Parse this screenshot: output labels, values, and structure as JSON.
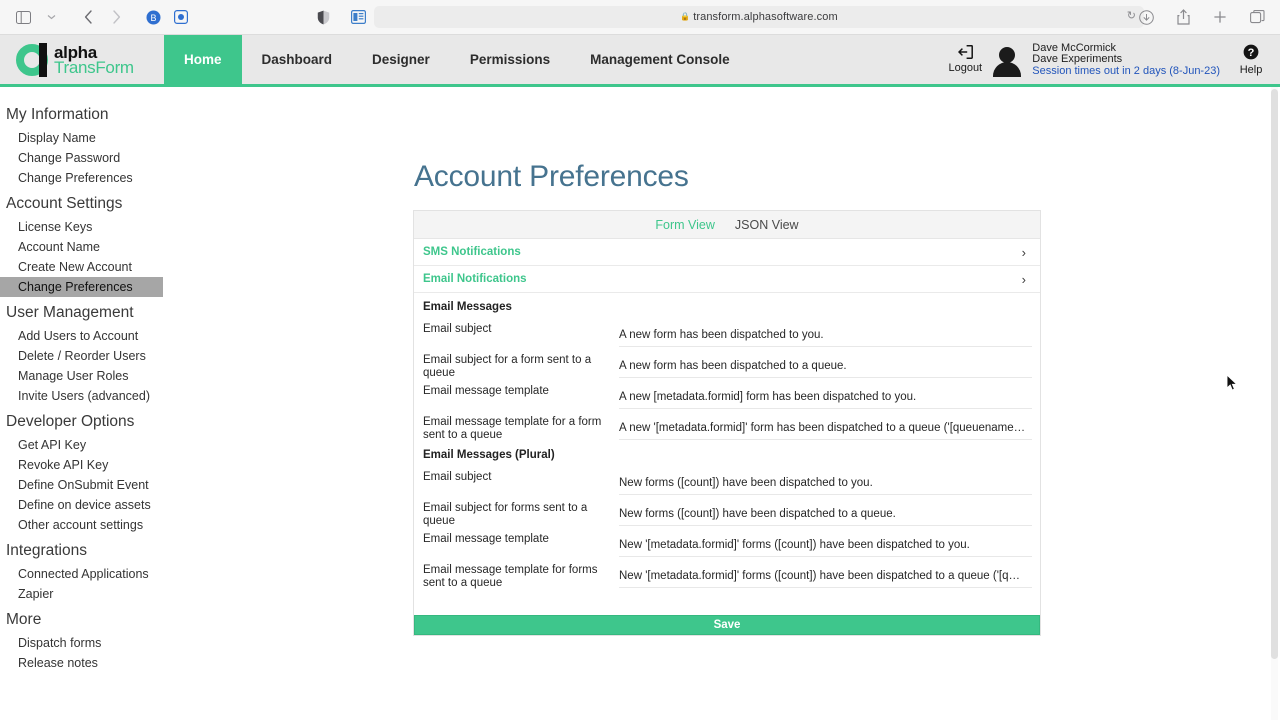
{
  "browser": {
    "url": "transform.alphasoftware.com",
    "lock_icon": "lock-icon",
    "sidebar_toggle_icon": "sidebar-toggle-icon",
    "dropdown_icon": "chevron-down-icon",
    "back_icon": "back-arrow-icon",
    "forward_icon": "forward-arrow-icon",
    "extension_one_icon": "bitwarden-extension-icon",
    "extension_two_icon": "screenshot-extension-icon",
    "shield_icon": "privacy-shield-icon",
    "reader_icon": "reader-view-icon",
    "reload_icon": "reload-icon",
    "download_icon": "download-icon",
    "share_icon": "share-icon",
    "newtab_icon": "new-tab-icon",
    "tabs_icon": "tab-overview-icon"
  },
  "header": {
    "logo_alpha": "alpha",
    "logo_transform": "TransForm",
    "nav": [
      {
        "label": "Home",
        "active": true
      },
      {
        "label": "Dashboard",
        "active": false
      },
      {
        "label": "Designer",
        "active": false
      },
      {
        "label": "Permissions",
        "active": false
      },
      {
        "label": "Management Console",
        "active": false
      }
    ],
    "logout_label": "Logout",
    "user_name": "Dave McCormick",
    "user_account": "Dave Experiments",
    "session_text": "Session times out in 2 days (8-Jun-23)",
    "help_label": "Help",
    "accent_color": "#3ec68c",
    "session_link_color": "#2255bb"
  },
  "sidebar": {
    "groups": [
      {
        "title": "My Information",
        "items": [
          {
            "label": "Display Name",
            "selected": false
          },
          {
            "label": "Change Password",
            "selected": false
          },
          {
            "label": "Change Preferences",
            "selected": false
          }
        ]
      },
      {
        "title": "Account Settings",
        "items": [
          {
            "label": "License Keys",
            "selected": false
          },
          {
            "label": "Account Name",
            "selected": false
          },
          {
            "label": "Create New Account",
            "selected": false
          },
          {
            "label": "Change Preferences",
            "selected": true
          }
        ]
      },
      {
        "title": "User Management",
        "items": [
          {
            "label": "Add Users to Account",
            "selected": false
          },
          {
            "label": "Delete / Reorder Users",
            "selected": false
          },
          {
            "label": "Manage User Roles",
            "selected": false
          },
          {
            "label": "Invite Users (advanced)",
            "selected": false
          }
        ]
      },
      {
        "title": "Developer Options",
        "items": [
          {
            "label": "Get API Key",
            "selected": false
          },
          {
            "label": "Revoke API Key",
            "selected": false
          },
          {
            "label": "Define OnSubmit Event",
            "selected": false
          },
          {
            "label": "Define on device assets",
            "selected": false
          },
          {
            "label": "Other account settings",
            "selected": false
          }
        ]
      },
      {
        "title": "Integrations",
        "items": [
          {
            "label": "Connected Applications",
            "selected": false
          },
          {
            "label": "Zapier",
            "selected": false
          }
        ]
      },
      {
        "title": "More",
        "items": [
          {
            "label": "Dispatch forms",
            "selected": false
          },
          {
            "label": "Release notes",
            "selected": false
          }
        ]
      }
    ]
  },
  "main": {
    "page_title": "Account Preferences",
    "title_color": "#46738f",
    "tabs": [
      {
        "label": "Form View",
        "active": true
      },
      {
        "label": "JSON View",
        "active": false
      }
    ],
    "accordions": [
      {
        "label": "SMS Notifications",
        "expanded": false
      },
      {
        "label": "Email Notifications",
        "expanded": true
      }
    ],
    "sections": [
      {
        "heading": "Email Messages",
        "fields": [
          {
            "label": "Email subject",
            "value": "A new form has been dispatched to you."
          },
          {
            "label": "Email subject for a form sent to a queue",
            "value": "A new form has been dispatched to a queue."
          },
          {
            "label": "Email message template",
            "value": "A new [metadata.formid] form has been dispatched to you."
          },
          {
            "label": "Email message template for a form sent to a queue",
            "value": "A new '[metadata.formid]' form has been dispatched to a queue ('[queuename]') you are s…"
          }
        ]
      },
      {
        "heading": "Email Messages (Plural)",
        "fields": [
          {
            "label": "Email subject",
            "value": "New forms ([count]) have been dispatched to you."
          },
          {
            "label": "Email subject for forms sent to a queue",
            "value": "New forms ([count]) have been dispatched to a queue."
          },
          {
            "label": "Email message template",
            "value": "New '[metadata.formid]' forms ([count]) have been dispatched to you."
          },
          {
            "label": "Email message template for forms sent to a queue",
            "value": "New '[metadata.formid]' forms ([count]) have been dispatched to a queue ('[queuename]')…"
          }
        ]
      }
    ],
    "save_label": "Save",
    "save_color": "#3ec68c"
  }
}
